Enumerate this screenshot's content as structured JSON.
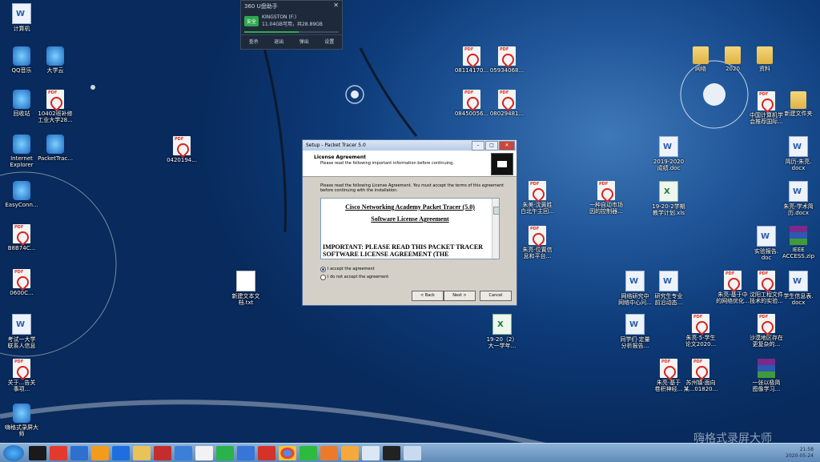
{
  "desktop_icons": [
    {
      "label": "计算机",
      "type": "doc"
    },
    {
      "label": "QQ音乐",
      "type": "app"
    },
    {
      "label": "大学云",
      "type": "app"
    },
    {
      "label": "回收站",
      "type": "app"
    },
    {
      "label": "10402班补修\n工业大学28...",
      "type": "pdf"
    },
    {
      "label": "Internet\nExplorer",
      "type": "app"
    },
    {
      "label": "PacketTrac...",
      "type": "app"
    },
    {
      "label": "EasyConn...",
      "type": "app"
    },
    {
      "label": "0420194...",
      "type": "pdf"
    },
    {
      "label": "B8B74C...",
      "type": "pdf"
    },
    {
      "label": "0600C...",
      "type": "pdf"
    },
    {
      "label": "考试一大学\n联系人信息",
      "type": "doc"
    },
    {
      "label": "关于...告关\n事项...",
      "type": "pdf"
    },
    {
      "label": "嗨格式录屏大\n师",
      "type": "app"
    },
    {
      "label": "新建文本文\n档.txt",
      "type": "txt"
    },
    {
      "label": "08114170...",
      "type": "pdf"
    },
    {
      "label": "05934068...",
      "type": "pdf"
    },
    {
      "label": "08450056...",
      "type": "pdf"
    },
    {
      "label": "08029481...",
      "type": "pdf"
    },
    {
      "label": "朱美·沈黄胜\n白北午主回...",
      "type": "pdf"
    },
    {
      "label": "一种自动市场\n因的控制器...",
      "type": "pdf"
    },
    {
      "label": "朱亮·位置信\n息和平台...",
      "type": "pdf"
    },
    {
      "label": "19-20（2）\n大一学年...",
      "type": "xls"
    },
    {
      "label": "2019-2020\n成绩.doc",
      "type": "doc"
    },
    {
      "label": "19-20-2学期\n教学计划.xls",
      "type": "xls"
    },
    {
      "label": "网络",
      "type": "folder"
    },
    {
      "label": "2020",
      "type": "folder"
    },
    {
      "label": "资料",
      "type": "folder"
    },
    {
      "label": "中国计算机学\n会推荐国际...",
      "type": "pdf"
    },
    {
      "label": "新建文件夹",
      "type": "folder"
    },
    {
      "label": "简历-朱亮.\ndocx",
      "type": "doc"
    },
    {
      "label": "朱亮-学术简\n历.docx",
      "type": "doc"
    },
    {
      "label": "实验报告.\ndoc",
      "type": "doc"
    },
    {
      "label": "IEEE\nACCESS.zip",
      "type": "rar"
    },
    {
      "label": "网络研究中\n网络中心问...",
      "type": "doc"
    },
    {
      "label": "研究生专业\n前沿动态...",
      "type": "doc"
    },
    {
      "label": "朱亮-基于中\n的网络优化...",
      "type": "pdf"
    },
    {
      "label": "沈阳工程文件\n技术的实验...",
      "type": "pdf"
    },
    {
      "label": "学生信息表.\ndocx",
      "type": "doc"
    },
    {
      "label": "同学们·定量\n分析报告...",
      "type": "doc"
    },
    {
      "label": "朱亮·5·学生\n论文2020...",
      "type": "pdf"
    },
    {
      "label": "沙漠地区存在\n更复杂的...",
      "type": "pdf"
    },
    {
      "label": "朱亮·基于\n卷积神经...",
      "type": "pdf"
    },
    {
      "label": "苏州镇·面向\n某...01820...",
      "type": "pdf"
    },
    {
      "label": "一张以极简\n图像学习...",
      "type": "rar"
    }
  ],
  "popup": {
    "title": "360 U盘助手",
    "badge": "安全",
    "device": "KINGSTON (F:)",
    "usage": "11.04GB可用，共28.89GB",
    "actions": [
      "查杀",
      "退出",
      "弹出",
      "设置"
    ]
  },
  "setup_window": {
    "title": "Setup - Packet Tracer 5.0",
    "header_title": "License Agreement",
    "header_sub": "Please read the following important information before continuing.",
    "intro": "Please read the following License Agreement. You must accept the terms of this agreement before continuing with the installation.",
    "license_title": "Cisco Networking Academy Packet Tracer (5.0)",
    "license_subtitle": "Software License Agreement",
    "license_body": "IMPORTANT: PLEASE READ THIS PACKET TRACER SOFTWARE LICENSE AGREEMENT (THE",
    "radio_accept": "I accept the agreement",
    "radio_decline": "I do not accept the agreement",
    "accept_selected": true,
    "btn_back": "< Back",
    "btn_next": "Next >",
    "btn_cancel": "Cancel"
  },
  "taskbar": {
    "tray_time": "21:58",
    "tray_date": "2020-05-24"
  },
  "watermark": "嗨格式录屏大师"
}
